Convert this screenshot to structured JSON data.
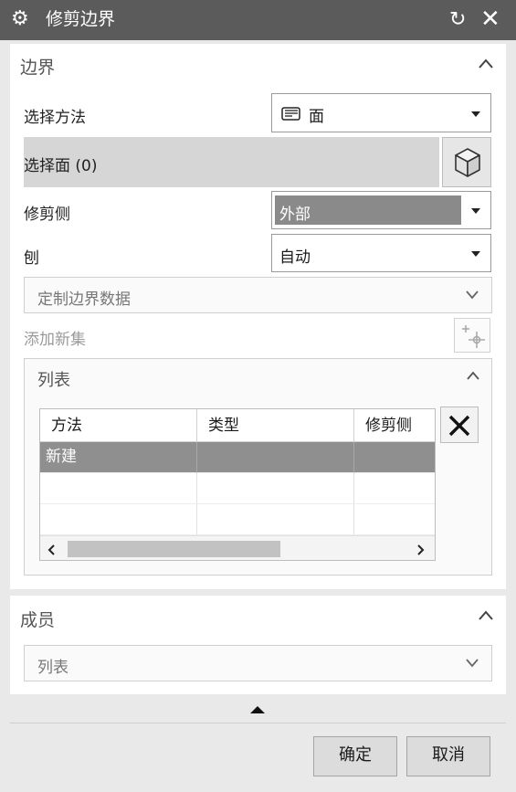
{
  "window": {
    "title": "修剪边界",
    "gear_icon": "⚙",
    "reset_icon": "↻",
    "close_icon": "✕"
  },
  "boundary_section": {
    "header": "边界",
    "select_method": {
      "label": "选择方法",
      "value": "面",
      "icon": "face-icon"
    },
    "select_face": {
      "label": "选择面 (0)"
    },
    "trim_side": {
      "label": "修剪侧",
      "value": "外部"
    },
    "plane": {
      "label": "刨",
      "value": "自动"
    },
    "custom_boundary": {
      "label": "定制边界数据"
    },
    "add_new_set": {
      "label": "添加新集"
    },
    "list": {
      "header": "列表",
      "columns": [
        "方法",
        "类型",
        "修剪侧"
      ],
      "rows": [
        [
          "新建",
          "",
          ""
        ],
        [
          "",
          "",
          ""
        ],
        [
          "",
          "",
          ""
        ]
      ]
    }
  },
  "member_section": {
    "header": "成员",
    "list": {
      "label": "列表"
    }
  },
  "footer": {
    "ok_label": "确定",
    "cancel_label": "取消"
  }
}
